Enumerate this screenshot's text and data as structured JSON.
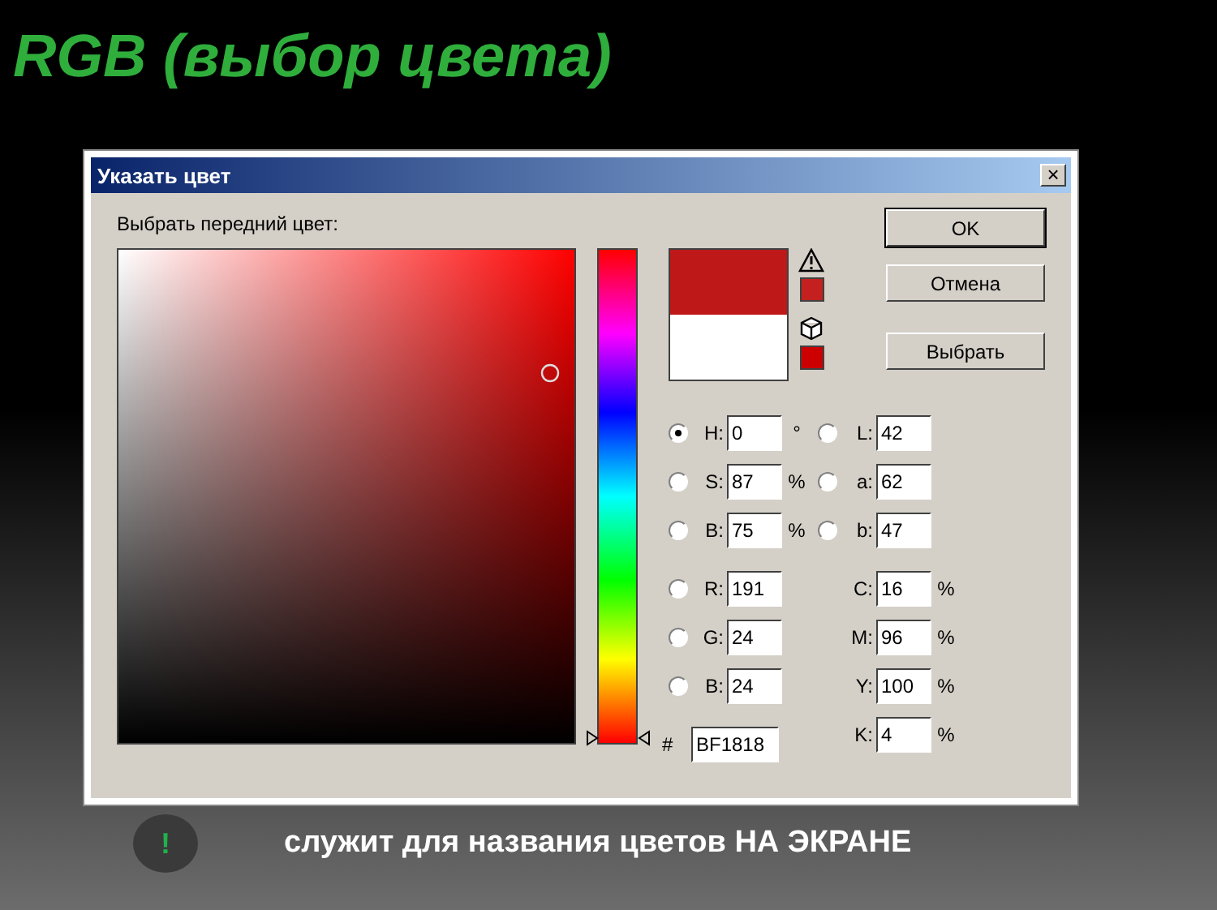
{
  "slide_title": "RGB (выбор цвета)",
  "window": {
    "title": "Указать цвет",
    "close": "×"
  },
  "prompt": "Выбрать передний цвет:",
  "hue_slider": {
    "level": 0
  },
  "preview": [
    {
      "kind": "new",
      "color": "#bf1818"
    },
    {
      "kind": "current",
      "color": "#ffffff"
    }
  ],
  "gamut_warnings": [
    {
      "kind": "print",
      "color": "#c42020"
    },
    {
      "kind": "web",
      "color": "#cc0000"
    }
  ],
  "buttons": [
    {
      "label": "OK",
      "default": true
    },
    {
      "label": "Отмена",
      "default": false
    },
    {
      "label": "Выбрать",
      "default": false
    }
  ],
  "left_groups": [
    [
      {
        "kind": "radio",
        "selected": true,
        "label": "H:",
        "value": "0",
        "unit": "°"
      },
      {
        "kind": "radio",
        "selected": false,
        "label": "S:",
        "value": "87",
        "unit": "%"
      },
      {
        "kind": "radio",
        "selected": false,
        "label": "B:",
        "value": "75",
        "unit": "%"
      }
    ],
    [
      {
        "kind": "radio",
        "selected": false,
        "label": "R:",
        "value": "191"
      },
      {
        "kind": "radio",
        "selected": false,
        "label": "G:",
        "value": "24"
      },
      {
        "kind": "radio",
        "selected": false,
        "label": "B:",
        "value": "24"
      }
    ]
  ],
  "right_groups": [
    [
      {
        "kind": "radio",
        "selected": false,
        "label": "L:",
        "value": "42"
      },
      {
        "kind": "radio",
        "selected": false,
        "label": "a:",
        "value": "62"
      },
      {
        "kind": "radio",
        "selected": false,
        "label": "b:",
        "value": "47"
      }
    ],
    [
      {
        "kind": "plain",
        "label": "C:",
        "value": "16",
        "unit": "%"
      },
      {
        "kind": "plain",
        "label": "M:",
        "value": "96",
        "unit": "%"
      },
      {
        "kind": "plain",
        "label": "Y:",
        "value": "100",
        "unit": "%"
      },
      {
        "kind": "plain",
        "label": "K:",
        "value": "4",
        "unit": "%"
      }
    ]
  ],
  "hex": {
    "label": "#",
    "value": "BF1818"
  },
  "note": {
    "icon": "!",
    "text": "служит для названия цветов НА ЭКРАНЕ"
  }
}
